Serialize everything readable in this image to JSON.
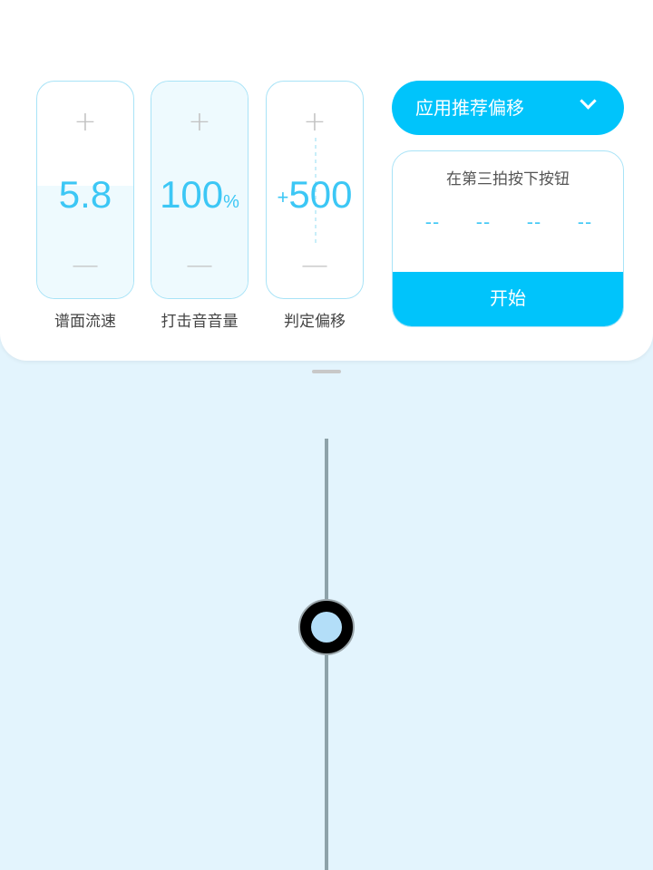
{
  "steppers": [
    {
      "label": "谱面流速",
      "value": "5.8",
      "suffix": "",
      "prefix": "",
      "plus": "+",
      "minus": "—",
      "fill_fraction": 0.52
    },
    {
      "label": "打击音音量",
      "value": "100",
      "suffix": "%",
      "prefix": "",
      "plus": "+",
      "minus": "—",
      "fill_fraction": 1.0
    },
    {
      "label": "判定偏移",
      "value": "500",
      "suffix": "",
      "prefix": "+",
      "plus": "+",
      "minus": "—",
      "fill_fraction": 0.0
    }
  ],
  "dropdown": {
    "label": "应用推荐偏移",
    "icon": "chevron-down-icon"
  },
  "calibration": {
    "instruction": "在第三拍按下按钮",
    "beats": [
      "--",
      "--",
      "--",
      "--"
    ],
    "start_label": "开始"
  },
  "colors": {
    "accent": "#00c4fb",
    "value_text": "#3cc7f5",
    "background": "#e3f4fd",
    "knob_inner": "#b3def8"
  }
}
